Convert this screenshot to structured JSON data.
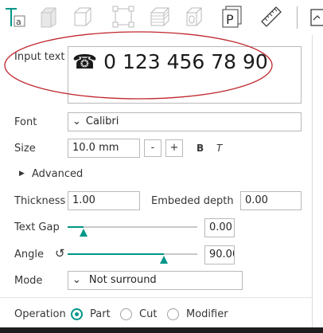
{
  "toolbar": {
    "tools": [
      {
        "name": "text-tool-icon",
        "active": true
      },
      {
        "name": "fill-bed-icon",
        "active": false
      },
      {
        "name": "cube-icon",
        "active": false
      },
      {
        "name": "scale-icon",
        "active": false
      },
      {
        "name": "layers-cube-icon",
        "active": false
      },
      {
        "name": "cylinder-icon",
        "active": false
      },
      {
        "name": "place-on-face-icon",
        "active": false
      },
      {
        "name": "measure-ruler-icon",
        "active": false
      },
      {
        "name": "assembly-icon",
        "active": false
      }
    ],
    "text_glyph": "a",
    "place_glyph": "P"
  },
  "input_text": {
    "label": "Input text",
    "value": "☎ 0 123 456 78 90"
  },
  "font": {
    "label": "Font",
    "value": "Calibri",
    "chevron": "⌄"
  },
  "size": {
    "label": "Size",
    "value": "10.0 mm",
    "minus": "-",
    "plus": "+",
    "bold": "B",
    "italic": "T"
  },
  "advanced": {
    "arrow": "▶",
    "label": "Advanced"
  },
  "thickness": {
    "label": "Thickness",
    "value": "1.00"
  },
  "embeded_depth": {
    "label": "Embeded depth",
    "value": "0.00"
  },
  "text_gap": {
    "label": "Text Gap",
    "value": "0.00",
    "position": 0.12
  },
  "angle": {
    "label": "Angle",
    "value": "90.00",
    "position": 0.74,
    "reset_icon": "↺"
  },
  "mode": {
    "label": "Mode",
    "value": "Not surround",
    "chevron": "⌄"
  },
  "operation": {
    "label": "Operation",
    "options": [
      "Part",
      "Cut",
      "Modifier"
    ],
    "selected": "Part"
  },
  "colors": {
    "accent": "#009688",
    "highlight_ellipse": "#c0272d"
  }
}
